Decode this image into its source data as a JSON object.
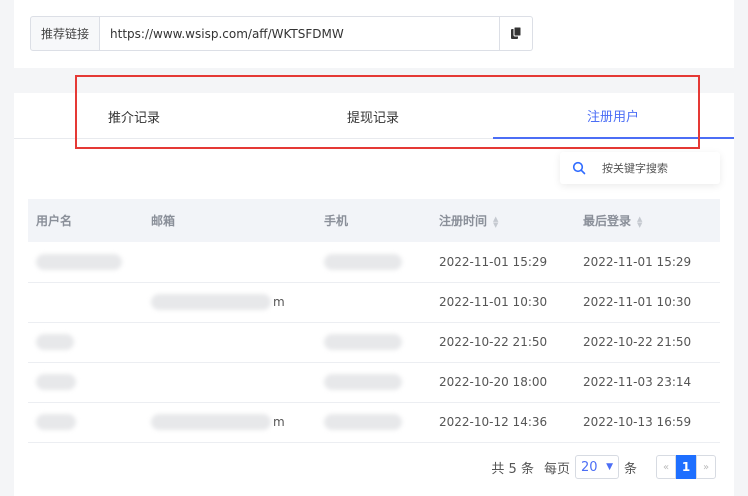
{
  "referral": {
    "label": "推荐链接",
    "url": "https://www.wsisp.com/aff/WKTSFDMW"
  },
  "tabs": [
    {
      "label": "推介记录",
      "active": false
    },
    {
      "label": "提现记录",
      "active": false
    },
    {
      "label": "注册用户",
      "active": true
    }
  ],
  "search": {
    "placeholder": "按关键字搜索"
  },
  "table": {
    "columns": [
      "用户名",
      "邮箱",
      "手机",
      "注册时间",
      "最后登录"
    ],
    "rows": [
      {
        "username": "",
        "email": "",
        "phone": "",
        "registered": "2022-11-01 15:29",
        "last_login": "2022-11-01 15:29"
      },
      {
        "username": "",
        "email": "m",
        "phone": "",
        "registered": "2022-11-01 10:30",
        "last_login": "2022-11-01 10:30"
      },
      {
        "username": "",
        "email": "",
        "phone": "",
        "registered": "2022-10-22 21:50",
        "last_login": "2022-10-22 21:50"
      },
      {
        "username": "",
        "email": "",
        "phone": "",
        "registered": "2022-10-20 18:00",
        "last_login": "2022-11-03 23:14"
      },
      {
        "username": "",
        "email": "m",
        "phone": "",
        "registered": "2022-10-12 14:36",
        "last_login": "2022-10-13 16:59"
      }
    ]
  },
  "pagination": {
    "total_text": "共 5 条",
    "per_page_label": "每页",
    "page_size": "20",
    "unit": "条",
    "prev": "«",
    "current": "1",
    "next": "»"
  },
  "colors": {
    "accent": "#4c6ef5",
    "highlight_border": "#e53935",
    "page_active": "#1e6fff"
  }
}
